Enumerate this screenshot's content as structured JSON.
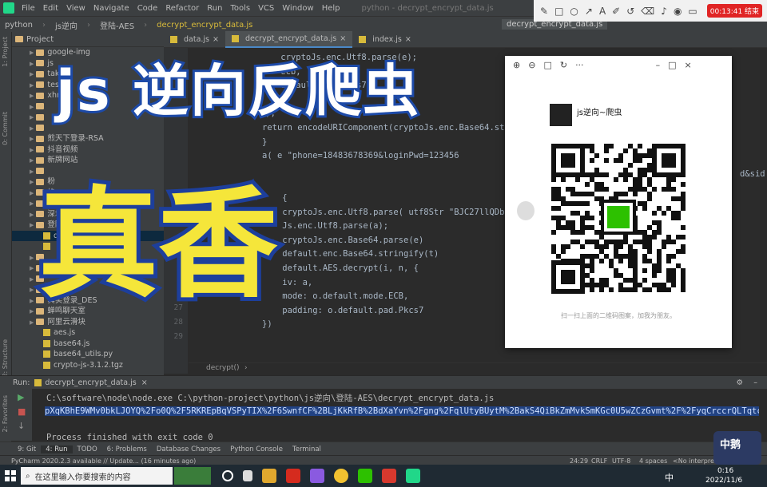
{
  "menubar": {
    "items": [
      "File",
      "Edit",
      "View",
      "Navigate",
      "Code",
      "Refactor",
      "Run",
      "Tools",
      "VCS",
      "Window",
      "Help"
    ],
    "title": "python - decrypt_encrypt_data.js"
  },
  "breadcrumb": {
    "items": [
      "python",
      "js逆向",
      "登陆-AES",
      "decrypt_encrypt_data.js"
    ],
    "run_config": "decrypt_encrypt_data.js"
  },
  "side_labels": {
    "project": "1: Project",
    "commit": "0: Commit",
    "structure": "2: Structure",
    "favorites": "2: Favorites"
  },
  "project": {
    "header": "Project",
    "rows": [
      {
        "label": "google-img",
        "type": "folder"
      },
      {
        "label": "js",
        "type": "folder"
      },
      {
        "label": "tak",
        "type": "folder"
      },
      {
        "label": "test",
        "type": "folder"
      },
      {
        "label": "xhr",
        "type": "folder"
      },
      {
        "label": "",
        "type": "folder"
      },
      {
        "label": "",
        "type": "folder"
      },
      {
        "label": "",
        "type": "folder"
      },
      {
        "label": "煎天下登录-RSA",
        "type": "folder"
      },
      {
        "label": "抖音视频",
        "type": "folder"
      },
      {
        "label": "新牌网站",
        "type": "folder"
      },
      {
        "label": "",
        "type": "folder"
      },
      {
        "label": "粉",
        "type": "folder"
      },
      {
        "label": "格",
        "type": "folder"
      },
      {
        "label": "毛毛",
        "type": "folder"
      },
      {
        "label": "深圳",
        "type": "folder"
      },
      {
        "label": "登陆-A",
        "type": "folder"
      },
      {
        "label": "da",
        "type": "file"
      },
      {
        "label": "",
        "type": "file"
      },
      {
        "label": "",
        "type": "folder"
      },
      {
        "label": "网",
        "type": "folder"
      },
      {
        "label": "",
        "type": "folder"
      },
      {
        "label": "",
        "type": "folder"
      },
      {
        "label": "真实登录_DES",
        "type": "folder"
      },
      {
        "label": "蝉鸣聊天室",
        "type": "folder"
      },
      {
        "label": "阿里云滑块",
        "type": "folder"
      },
      {
        "label": "aes.js",
        "type": "file"
      },
      {
        "label": "base64.js",
        "type": "file"
      },
      {
        "label": "base64_utils.py",
        "type": "file"
      },
      {
        "label": "crypto-js-3.1.2.tgz",
        "type": "file"
      }
    ]
  },
  "tabs": [
    {
      "label": "data.js",
      "active": false
    },
    {
      "label": "decrypt_encrypt_data.js",
      "active": true
    },
    {
      "label": "index.js",
      "active": false
    }
  ],
  "editor": {
    "line_numbers": [
      "27",
      "28",
      "29"
    ],
    "lines": [
      "    cryptoJs.enc.Utf8.parse(e);",
      "    ecb,",
      "    default.pad.Pkcs7",
      "",
      "});",
      "return encodeURIComponent(cryptoJs.enc.Base64.stri",
      "}",
      "a( e \"phone=18483678369&loginPwd=123456",
      "",
      "",
      "    {",
      "    cryptoJs.enc.Utf8.parse( utf8Str \"BJC27llQDbviqM",
      "    Js.enc.Utf8.parse(a);",
      "    cryptoJs.enc.Base64.parse(e)",
      "    default.enc.Base64.stringify(t)",
      "    default.AES.decrypt(i, n, {",
      "    iv: a,",
      "    mode: o.default.mode.ECB,",
      "    padding: o.default.pad.Pkcs7",
      "})"
    ],
    "right_overflow": "d&sid",
    "footer_crumb": "decrypt()",
    "footer_arrow": "›"
  },
  "run": {
    "label": "Run:",
    "tab": "decrypt_encrypt_data.js",
    "command": "C:\\software\\node\\node.exe C:\\python-project\\python\\js逆向\\登陆-AES\\decrypt_encrypt_data.js",
    "output": "pXqKBhE9WMv0bkLJOYQ%2Fo0Q%2F5RKREpBqVSPyTIX%2F6SwnfCF%2BLjKkRfB%2BdXaYvn%2Fgng%2FqlUtyBUytM%2BakS4QiBkZmMvkSmKGc0U5wZCzGvmt%2F%2FyqCrccrQLTqtcYEKEN4",
    "exit": "Process finished with exit code 0"
  },
  "tool_tabs": [
    "9: Git",
    "4: Run",
    "TODO",
    "6: Problems",
    "Database Changes",
    "Python Console",
    "Terminal"
  ],
  "status": {
    "left": "PyCharm 2020.2.3 available // Update... (16 minutes ago)",
    "position": "24:29",
    "line_sep": "CRLF",
    "encoding": "UTF-8",
    "indent": "4 spaces",
    "interpreter": "<No interpreter>"
  },
  "taskbar": {
    "search_placeholder": "在这里输入你要搜索的内容",
    "ime": "中",
    "time": "0:16",
    "date": "2022/11/6"
  },
  "overlay": {
    "line1": "js 逆向反爬虫",
    "line2": "真香"
  },
  "qr_window": {
    "account": "js逆向~爬虫",
    "footer": "扫一扫上面的二维码图案，加我为朋友。"
  },
  "recorder": {
    "timer": "00:13:41 结束"
  },
  "badge": {
    "text": "中鹅"
  }
}
